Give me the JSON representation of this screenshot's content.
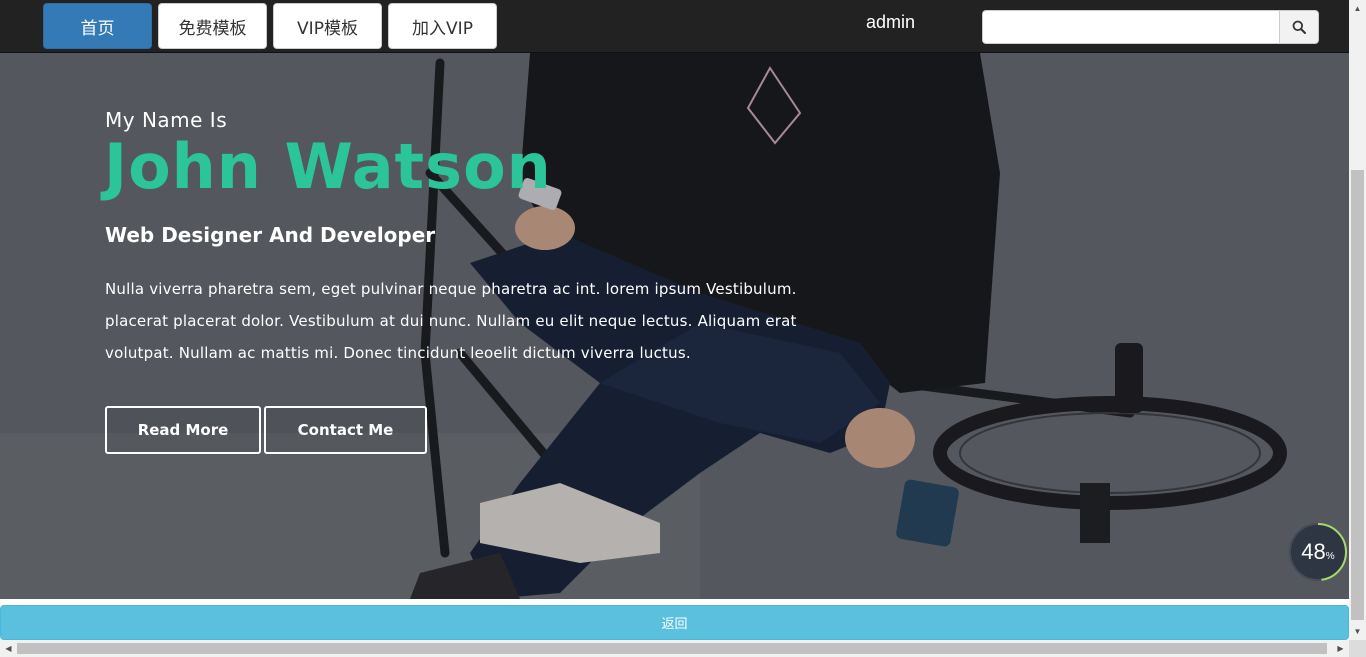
{
  "nav": {
    "items": [
      {
        "label": "首页",
        "active": true
      },
      {
        "label": "免费模板",
        "active": false
      },
      {
        "label": "VIP模板",
        "active": false
      },
      {
        "label": "加入VIP",
        "active": false
      }
    ],
    "user": "admin",
    "search_placeholder": "",
    "search_icon": "search-icon"
  },
  "hero": {
    "kicker": "My Name Is",
    "name": "John Watson",
    "role": "Web Designer And Developer",
    "description": "Nulla viverra pharetra sem, eget pulvinar neque pharetra ac int. lorem ipsum Vestibulum. placerat placerat dolor. Vestibulum at dui nunc. Nullam eu elit neque lectus. Aliquam erat volutpat. Nullam ac mattis mi. Donec tincidunt leoelit dictum viverra luctus.",
    "buttons": {
      "read_more": "Read More",
      "contact": "Contact Me"
    }
  },
  "progress": {
    "value": "48",
    "unit": "%",
    "fraction": 0.48
  },
  "footer": {
    "back_label": "返回"
  },
  "colors": {
    "accent": "#2bc49b",
    "nav_active": "#337ab7",
    "back_bar": "#5bc0de",
    "topbar": "#222222"
  }
}
